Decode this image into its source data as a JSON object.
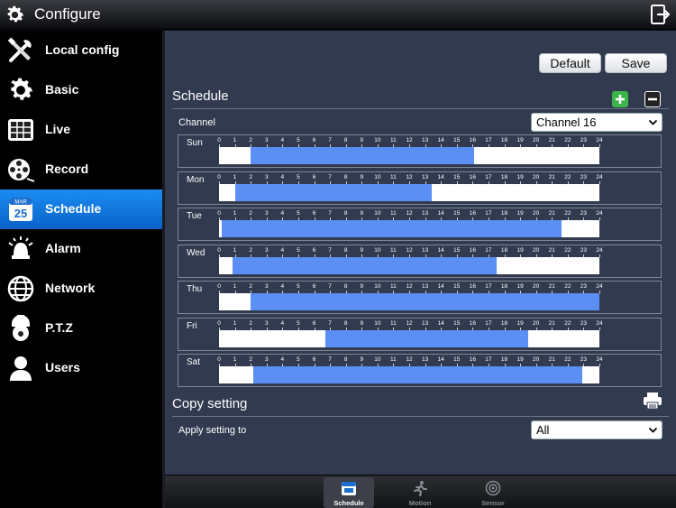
{
  "titlebar": {
    "title": "Configure",
    "icon": "gear-icon",
    "exit_icon": "exit-icon"
  },
  "sidebar": {
    "items": [
      {
        "label": "Local config",
        "icon": "tools-icon",
        "active": false
      },
      {
        "label": "Basic",
        "icon": "gear-icon",
        "active": false
      },
      {
        "label": "Live",
        "icon": "grid-icon",
        "active": false
      },
      {
        "label": "Record",
        "icon": "film-reel-icon",
        "active": false
      },
      {
        "label": "Schedule",
        "icon": "calendar-icon",
        "active": true,
        "calendar_day": "25",
        "calendar_month": "MAR"
      },
      {
        "label": "Alarm",
        "icon": "alarm-bell-icon",
        "active": false
      },
      {
        "label": "Network",
        "icon": "globe-icon",
        "active": false
      },
      {
        "label": "P.T.Z",
        "icon": "ptz-camera-icon",
        "active": false
      },
      {
        "label": "Users",
        "icon": "user-icon",
        "active": false
      }
    ]
  },
  "toolbar": {
    "default_label": "Default",
    "save_label": "Save"
  },
  "schedule": {
    "title": "Schedule",
    "add_icon": "plus-icon",
    "remove_icon": "minus-icon",
    "channel_label": "Channel",
    "channel_value": "Channel 16",
    "hour_labels": [
      "0",
      "1",
      "2",
      "3",
      "4",
      "5",
      "6",
      "7",
      "8",
      "9",
      "10",
      "11",
      "12",
      "13",
      "14",
      "15",
      "16",
      "17",
      "18",
      "19",
      "20",
      "21",
      "22",
      "23",
      "24"
    ],
    "days": [
      {
        "name": "Sun",
        "start_hour": 2.0,
        "end_hour": 16.1
      },
      {
        "name": "Mon",
        "start_hour": 1.0,
        "end_hour": 13.4
      },
      {
        "name": "Tue",
        "start_hour": 0.15,
        "end_hour": 21.6
      },
      {
        "name": "Wed",
        "start_hour": 0.85,
        "end_hour": 17.5
      },
      {
        "name": "Thu",
        "start_hour": 2.0,
        "end_hour": 24.0
      },
      {
        "name": "Fri",
        "start_hour": 6.7,
        "end_hour": 19.5
      },
      {
        "name": "Sat",
        "start_hour": 2.15,
        "end_hour": 22.9
      }
    ]
  },
  "copy_setting": {
    "title": "Copy setting",
    "print_icon": "printer-icon",
    "apply_label": "Apply setting to",
    "apply_value": "All"
  },
  "tabs": [
    {
      "label": "Schedule",
      "icon": "calendar-icon",
      "active": true
    },
    {
      "label": "Motion",
      "icon": "running-man-icon",
      "active": false
    },
    {
      "label": "Sensor",
      "icon": "sensor-icon",
      "active": false
    }
  ],
  "colors": {
    "accent": "#1a8cf2",
    "schedule_fill": "#5b8ff3",
    "panel_bg": "#313a4e",
    "add_green": "#3bb54a"
  }
}
